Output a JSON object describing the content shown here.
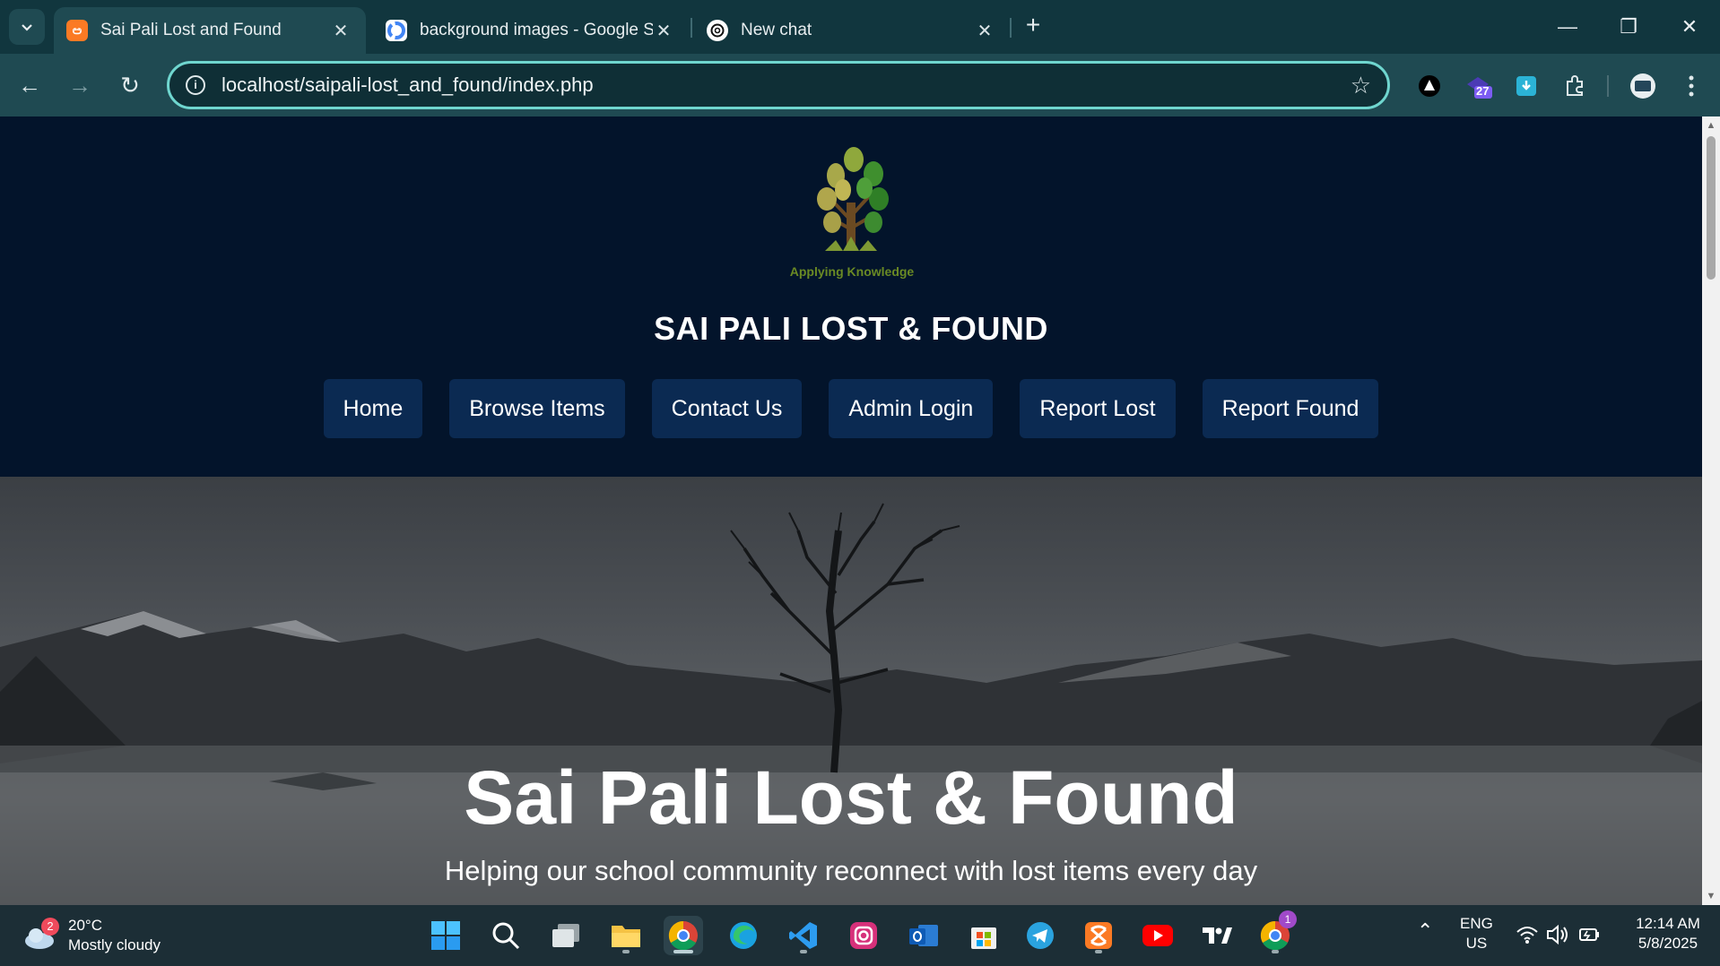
{
  "browser": {
    "tabs": [
      {
        "title": "Sai Pali Lost and Found",
        "icon": "xampp-icon"
      },
      {
        "title": "background images - Google S",
        "icon": "google-icon"
      },
      {
        "title": "New chat",
        "icon": "openai-icon"
      }
    ],
    "url": "localhost/saipali-lost_and_found/index.php",
    "extension_badge": "27"
  },
  "page": {
    "logo_caption": "Applying Knowledge",
    "site_title": "SAI PALI LOST & FOUND",
    "nav": [
      {
        "label": "Home"
      },
      {
        "label": "Browse Items"
      },
      {
        "label": "Contact Us"
      },
      {
        "label": "Admin Login"
      },
      {
        "label": "Report Lost"
      },
      {
        "label": "Report Found"
      }
    ],
    "hero": {
      "title": "Sai Pali Lost & Found",
      "subtitle": "Helping our school community reconnect with lost items every day"
    }
  },
  "taskbar": {
    "weather": {
      "badge": "2",
      "temp": "20°C",
      "condition": "Mostly cloudy"
    },
    "chrome_badge": "1",
    "language": {
      "line1": "ENG",
      "line2": "US"
    },
    "time": "12:14 AM",
    "date": "5/8/2025"
  },
  "colors": {
    "header_bg": "#03142b",
    "nav_button_bg": "#0b2a52",
    "omnibox_border": "#6fd6cf",
    "tabbar_bg": "#11363e"
  }
}
